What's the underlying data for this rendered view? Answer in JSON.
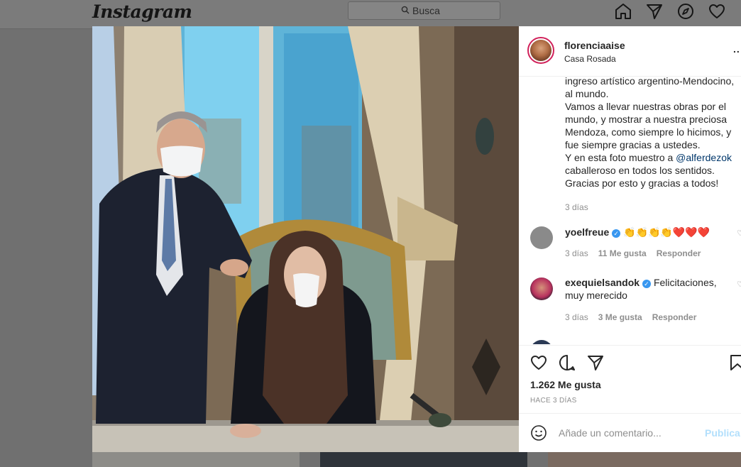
{
  "header": {
    "logo_text": "Instagram",
    "search_placeholder": "Busca",
    "icons": [
      "home-icon",
      "direct-icon",
      "explore-icon",
      "activity-heart-icon"
    ]
  },
  "post": {
    "username": "florenciaaise",
    "location": "Casa Rosada",
    "more_label": "..",
    "caption_lines": [
      "ingreso artístico argentino-Mendocino,",
      "al mundo.",
      "Vamos a llevar nuestras obras por el",
      "mundo, y mostrar a nuestra preciosa",
      "Mendoza, como siempre lo hicimos, y",
      "fue siempre gracias a ustedes."
    ],
    "caption_mention_prefix": "Y en esta foto muestro a ",
    "caption_mention": "@alferdezok",
    "caption_lines_end": [
      "caballeroso en todos los sentidos.",
      "Gracias por esto y gracias a todos!"
    ],
    "caption_time": "3 días",
    "comments": [
      {
        "username": "yoelfreue",
        "verified": true,
        "text": "👏👏👏👏❤️❤️❤️",
        "time": "3 días",
        "likes": "11 Me gusta",
        "reply": "Responder"
      },
      {
        "username": "exequielsandok",
        "verified": true,
        "text": "Felicitaciones, muy merecido",
        "time": "3 días",
        "likes": "3 Me gusta",
        "reply": "Responder"
      }
    ],
    "likes": "1.262 Me gusta",
    "posted": "HACE 3 DÍAS",
    "comment_placeholder": "Añade un comentario...",
    "post_button": "Publica"
  },
  "colors": {
    "overlay": "#707070",
    "accent_blue": "#3897f0",
    "mention": "#00376b",
    "post_disabled": "#b2dffc"
  }
}
